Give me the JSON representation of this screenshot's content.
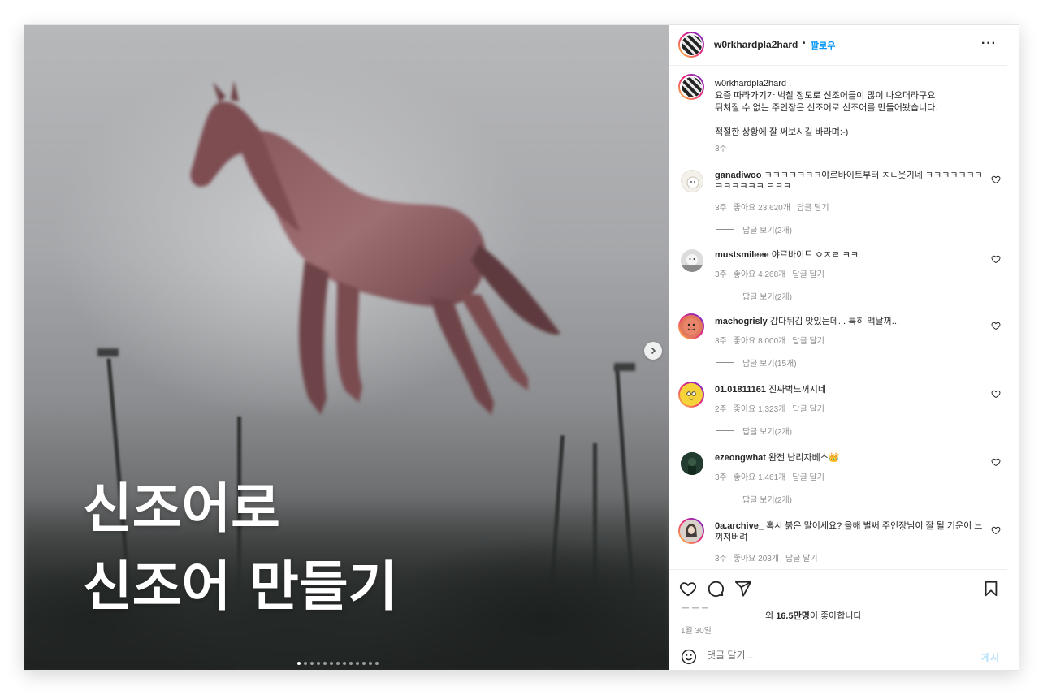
{
  "post": {
    "media": {
      "overlay_line1": "신조어로",
      "overlay_line2": "신조어 만들기",
      "carousel_dots": 13,
      "active_dot": 0
    },
    "header": {
      "username": "w0rkhardpla2hard",
      "separator": "•",
      "follow_label": "팔로우",
      "more_label": "···"
    },
    "caption": {
      "username": "w0rkhardpla2hard",
      "line1_suffix": " .",
      "line2": "요즘 따라가기가 벅찰 정도로 신조어들이 많이 나오더라구요",
      "line3": "뒤쳐질 수 없는 주인장은 신조어로 신조어를 만들어봤습니다.",
      "line4": "적절한 상황에 잘 써보시길 바라며:-)",
      "time": "3주"
    },
    "comments": [
      {
        "username": "ganadiwoo",
        "text": "ㅋㅋㅋㅋㅋㅋㅋ야르바이트부터 ㅈㄴ웃기네 ㅋㅋㅋㅋㅋㅋㅋㅋㅋㅋㅋㅋㅋ ㅋㅋㅋ",
        "time": "3주",
        "likes": "좋아요 23,620개",
        "reply": "답글 달기",
        "view_replies": "답글 보기(2개)"
      },
      {
        "username": "mustsmileee",
        "text": "야르바이트 ㅇㅈㄹ ㅋㅋ",
        "time": "3주",
        "likes": "좋아요 4,268개",
        "reply": "답글 달기",
        "view_replies": "답글 보기(2개)"
      },
      {
        "username": "machogrisly",
        "text": "감다뒤김 맛있는데... 특히 맥날꺼...",
        "time": "3주",
        "likes": "좋아요 8,000개",
        "reply": "답글 달기",
        "view_replies": "답글 보기(15개)"
      },
      {
        "username": "01.01811161",
        "text": "진짜벅느꺼지네",
        "time": "2주",
        "likes": "좋아요 1,323개",
        "reply": "답글 달기",
        "view_replies": "답글 보기(2개)"
      },
      {
        "username": "ezeongwhat",
        "text": "완전 난리자베스👑",
        "time": "3주",
        "likes": "좋아요 1,461개",
        "reply": "답글 달기",
        "view_replies": "답글 보기(2개)"
      },
      {
        "username": "0a.archive_",
        "text": "혹시 붉은 말이세요? 올해 벌써 주인장님이 잘 될 기운이 느껴져버려",
        "time": "3주",
        "likes": "좋아요 203개",
        "reply": "답글 달기",
        "view_replies": ""
      }
    ],
    "footer": {
      "likes_prefix": "외 ",
      "likes_count": "16.5만명",
      "likes_suffix": "이 좋아합니다",
      "date": "1월 30일",
      "comment_placeholder": "댓글 달기...",
      "post_label": "게시"
    },
    "icons": {
      "like": "heart-icon",
      "comment": "comment-icon",
      "share": "paper-plane-icon",
      "save": "bookmark-icon",
      "emoji": "emoji-icon",
      "next": "chevron-right-icon"
    },
    "colors": {
      "link_blue": "#0095f6",
      "post_disabled": "#b2dffc",
      "muted": "#8e8e8e"
    }
  }
}
